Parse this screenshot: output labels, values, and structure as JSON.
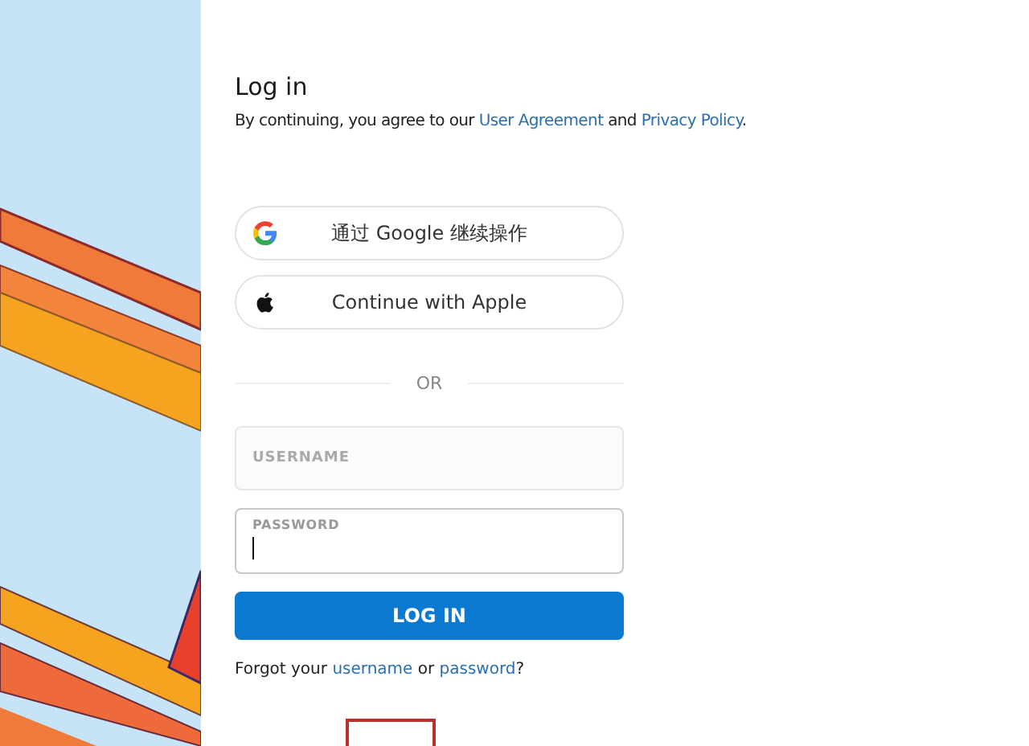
{
  "title": "Log in",
  "agreement": [
    {
      "kind": "text",
      "text": "By continuing, you agree to our "
    },
    {
      "kind": "link",
      "text": "User Agreement"
    },
    {
      "kind": "text",
      "text": " and "
    },
    {
      "kind": "link",
      "text": "Privacy Policy"
    },
    {
      "kind": "text",
      "text": "."
    }
  ],
  "social_buttons": [
    {
      "kind": "google",
      "label": "通过 Google 继续操作"
    },
    {
      "kind": "apple",
      "label": "Continue with Apple"
    }
  ],
  "divider": "OR",
  "username": {
    "placeholder": "USERNAME"
  },
  "password": {
    "label": "PASSWORD",
    "focused": true
  },
  "login_button": "LOG IN",
  "forgot": [
    {
      "kind": "text",
      "text": "Forgot your "
    },
    {
      "kind": "link",
      "text": "username"
    },
    {
      "kind": "text",
      "text": " or "
    },
    {
      "kind": "link",
      "text": "password"
    },
    {
      "kind": "text",
      "text": "?"
    }
  ]
}
